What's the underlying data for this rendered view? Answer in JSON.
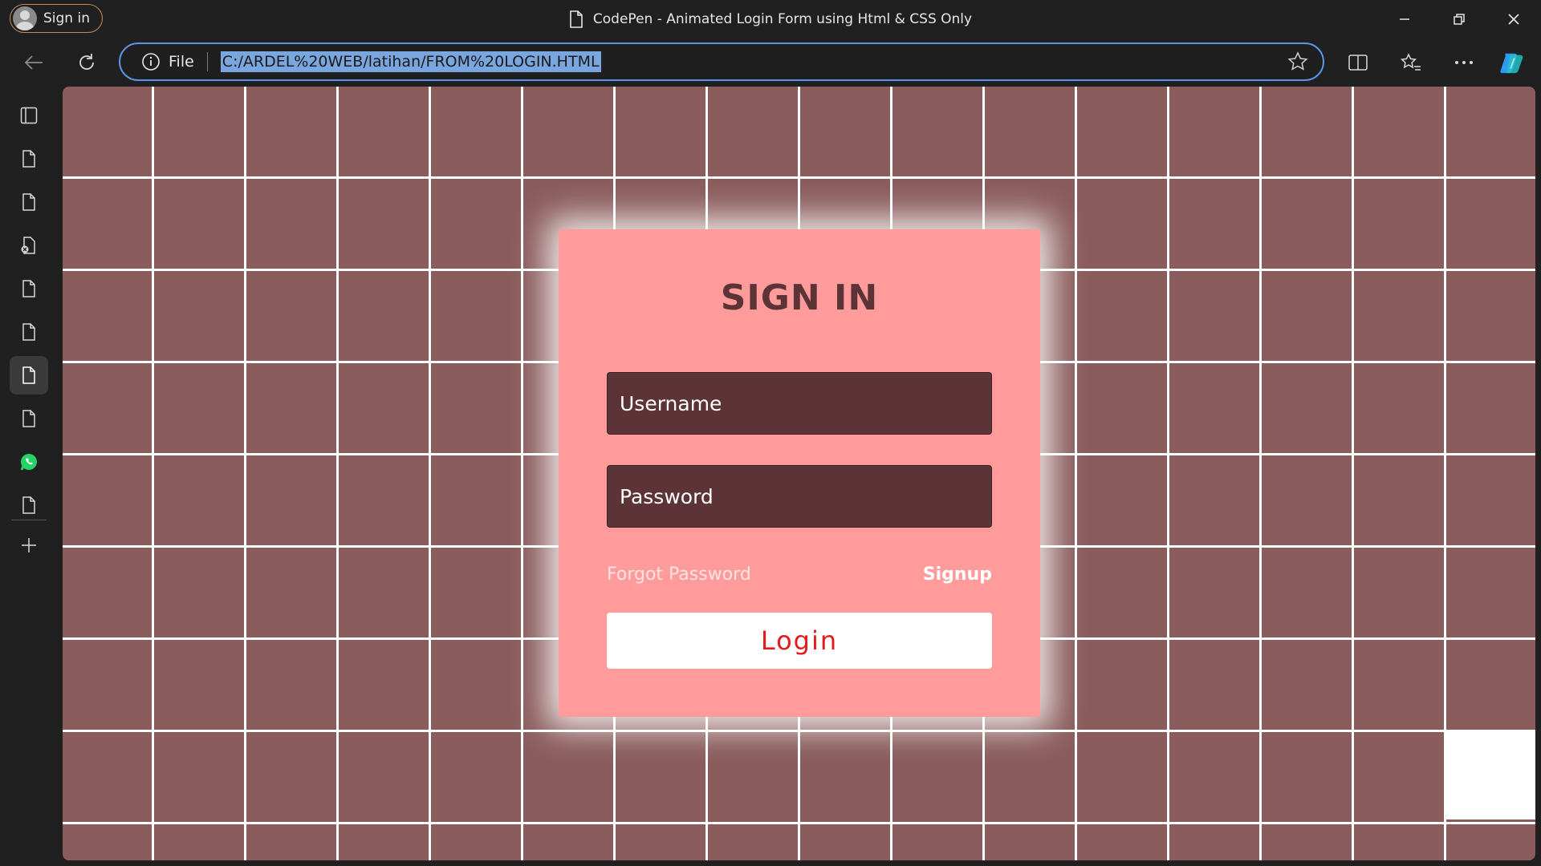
{
  "browser": {
    "profile_label": "Sign in",
    "tab_title": "CodePen - Animated Login Form using Html & CSS Only",
    "address": {
      "scheme_label": "File",
      "url": "C:/ARDEL%20WEB/latihan/FROM%20LOGIN.HTML"
    }
  },
  "login_form": {
    "title": "SIGN IN",
    "username_placeholder": "Username",
    "password_placeholder": "Password",
    "forgot_label": "Forgot Password",
    "signup_label": "Signup",
    "login_label": "Login"
  },
  "colors": {
    "background": "#8b5c5c",
    "grid_lines": "#ffffff",
    "card": "#ff9b9b",
    "field": "#5c3336",
    "button_text": "#e31b1b",
    "address_border": "#5b95e6"
  }
}
